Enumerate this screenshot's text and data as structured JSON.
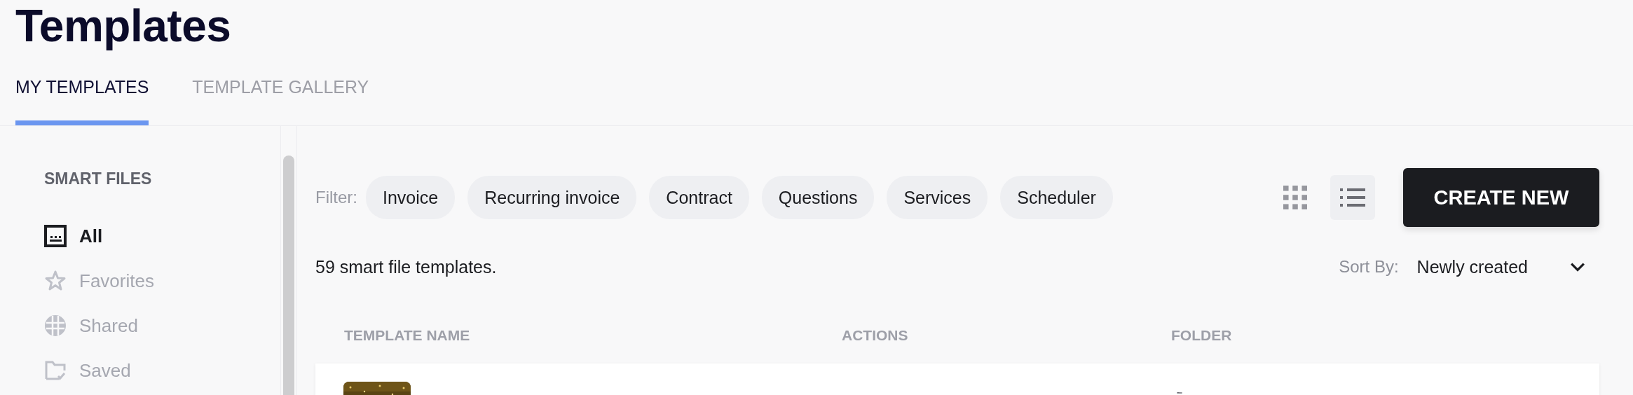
{
  "title": "Templates",
  "tabs": [
    {
      "label": "MY TEMPLATES",
      "selected": true
    },
    {
      "label": "TEMPLATE GALLERY",
      "selected": false
    }
  ],
  "sidebar": {
    "heading": "SMART FILES",
    "items": [
      {
        "label": "All",
        "selected": true
      },
      {
        "label": "Favorites",
        "selected": false
      },
      {
        "label": "Shared",
        "selected": false
      },
      {
        "label": "Saved",
        "selected": false
      }
    ]
  },
  "filter": {
    "label": "Filter:",
    "chips": [
      "Invoice",
      "Recurring invoice",
      "Contract",
      "Questions",
      "Services",
      "Scheduler"
    ]
  },
  "view_toggle": [
    {
      "kind": "grid",
      "selected": false
    },
    {
      "kind": "list",
      "selected": true
    }
  ],
  "create_button": "CREATE NEW",
  "count": "59 smart file templates.",
  "sort": {
    "label": "Sort By:",
    "value": "Newly created"
  },
  "table": {
    "columns": [
      "TEMPLATE NAME",
      "ACTIONS",
      "FOLDER"
    ],
    "rows": [
      {
        "kind": "picture"
      }
    ]
  }
}
